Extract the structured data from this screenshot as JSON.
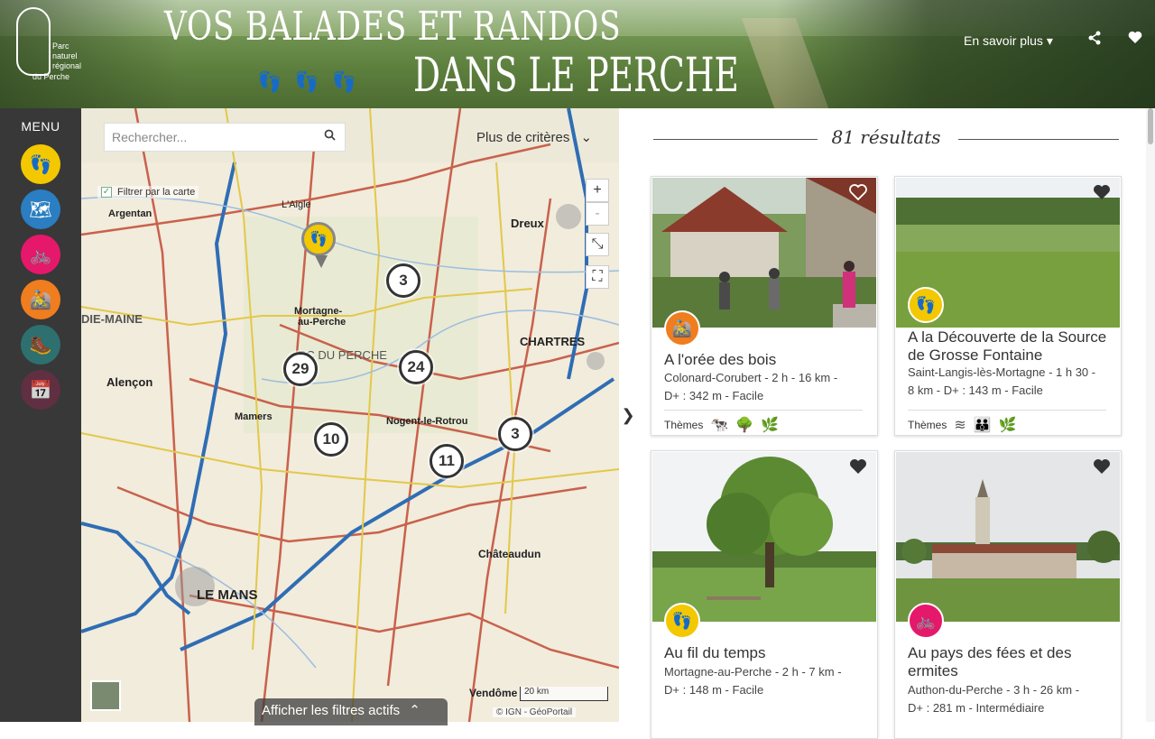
{
  "header": {
    "title_line1": "Vos balades et randos",
    "title_line2": "dans le Perche",
    "logo_text": "Parc naturel régional",
    "logo_sub": "du Perche",
    "info_link": "En savoir plus ▾",
    "share_icon": "share-icon",
    "favorites_icon": "heart-icon"
  },
  "sidebar": {
    "menu_label": "MENU",
    "items": [
      {
        "name": "walking",
        "icon": "footprints-icon",
        "color": "#f3c800",
        "glyph": "👣"
      },
      {
        "name": "map",
        "icon": "map-icon",
        "color": "#2a7ec1",
        "glyph": "🗺"
      },
      {
        "name": "cycling",
        "icon": "bike-icon",
        "color": "#e6186b",
        "glyph": "🚲"
      },
      {
        "name": "mountain-bike",
        "icon": "mtb-icon",
        "color": "#f07d1e",
        "glyph": "🚵"
      },
      {
        "name": "hiking",
        "icon": "hiker-icon",
        "color": "#2e6f6f",
        "glyph": "🥾"
      },
      {
        "name": "calendar",
        "icon": "calendar-icon",
        "color": "#6a2e44",
        "glyph": "📅"
      }
    ]
  },
  "map": {
    "search_placeholder": "Rechercher...",
    "criteria_label": "Plus de critères",
    "filter_label": "Filtrer par la carte",
    "zoom_in": "+",
    "zoom_out": "-",
    "clusters": [
      "3",
      "29",
      "24",
      "10",
      "3",
      "11"
    ],
    "place_labels": [
      "Dreux",
      "CHARTRES",
      "Mortagne-au-Perche",
      "Nogent-le-Rotrou",
      "Alençon",
      "LE MANS",
      "Mamers",
      "Châteaudun",
      "Vendôme",
      "Argentan",
      "L'Aigle"
    ],
    "show_filters": "Afficher les filtres actifs",
    "scale": "20 km",
    "attribution": "© IGN - GéoPortail",
    "collapse_arrow": "❯"
  },
  "results": {
    "count_label": "81 résultats",
    "cards": [
      {
        "name": "A l'orée des bois",
        "meta1": "Colonard-Corubert  -  2 h  -  16 km  -",
        "meta2": "D+ : 342 m  -  Facile",
        "themes_label": "Thèmes",
        "badge_color": "#f07d1e",
        "badge_glyph": "🚵"
      },
      {
        "name": "A la Découverte de la Source de Grosse Fontaine",
        "meta1": "Saint-Langis-lès-Mortagne  -  1 h 30  -",
        "meta2": "8 km  -  D+ : 143 m  -  Facile",
        "themes_label": "Thèmes",
        "badge_color": "#f3c800",
        "badge_glyph": "👣"
      },
      {
        "name": "Au fil du temps",
        "meta1": "Mortagne-au-Perche  -  2 h  -  7 km  -",
        "meta2": "D+ : 148 m  -  Facile",
        "badge_color": "#f3c800",
        "badge_glyph": "👣"
      },
      {
        "name": "Au pays des fées et des ermites",
        "meta1": "Authon-du-Perche  -  3 h  -  26 km  -",
        "meta2": "D+ : 281 m  -  Intermédiaire",
        "badge_color": "#e6186b",
        "badge_glyph": "🚲"
      }
    ]
  }
}
